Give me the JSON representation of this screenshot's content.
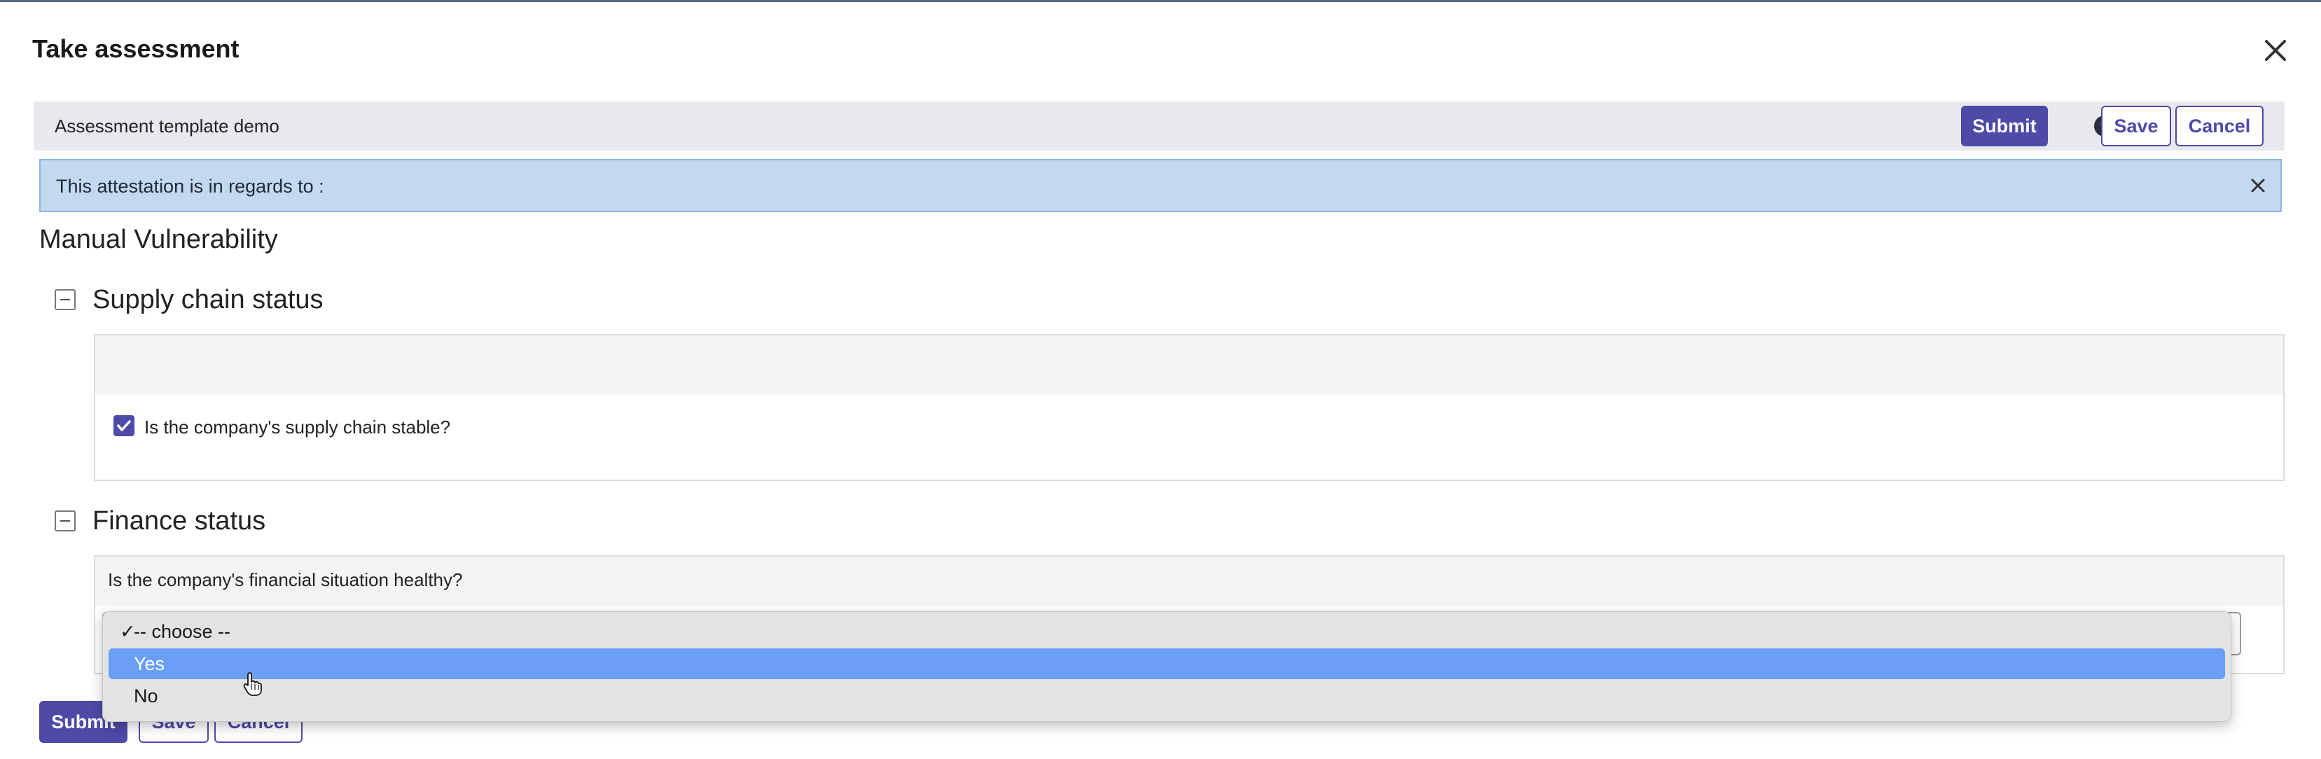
{
  "dialog": {
    "title": "Take assessment",
    "close_icon": "close-icon"
  },
  "template_bar": {
    "name": "Assessment template demo",
    "submit_label": "Submit",
    "help_icon": "question-circle-icon",
    "save_label": "Save",
    "cancel_label": "Cancel"
  },
  "banner": {
    "text": "This attestation is in regards to :",
    "close_icon": "close-icon"
  },
  "section": {
    "title": "Manual Vulnerability"
  },
  "groups": [
    {
      "title": "Supply chain status",
      "toggle_icon": "collapse-minus-icon",
      "questions": [
        {
          "label": "Is the company's supply chain stable?",
          "type": "checkbox",
          "checked": true
        }
      ]
    },
    {
      "title": "Finance status",
      "toggle_icon": "collapse-minus-icon",
      "questions": [
        {
          "label": "Is the company's financial situation healthy?",
          "type": "select",
          "selected": "-- choose --",
          "options": [
            "-- choose --",
            "Yes",
            "No"
          ],
          "highlighted": "Yes"
        }
      ]
    }
  ],
  "footer": {
    "submit_label": "Submit",
    "save_label": "Save",
    "cancel_label": "Cancel"
  },
  "colors": {
    "primary": "#4e4aa8",
    "banner_bg": "#c3d9f0",
    "highlight": "#6a9ff5"
  }
}
